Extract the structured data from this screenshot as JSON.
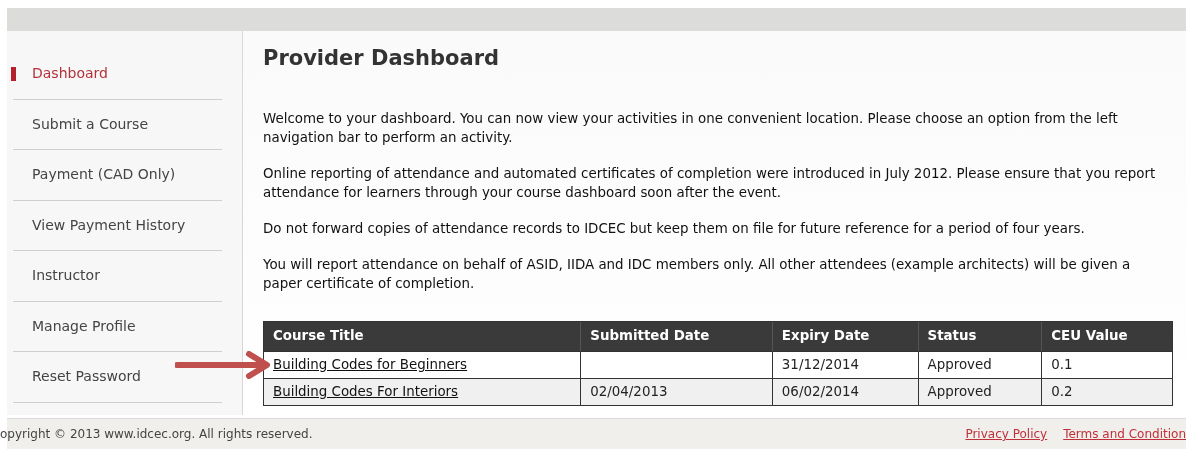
{
  "sidebar": {
    "items": [
      {
        "label": "Dashboard",
        "selected": true
      },
      {
        "label": "Submit a Course",
        "selected": false
      },
      {
        "label": "Payment (CAD Only)",
        "selected": false
      },
      {
        "label": "View Payment History",
        "selected": false
      },
      {
        "label": "Instructor",
        "selected": false
      },
      {
        "label": "Manage Profile",
        "selected": false
      },
      {
        "label": "Reset Password",
        "selected": false
      }
    ]
  },
  "page": {
    "title": "Provider Dashboard",
    "paragraphs": [
      "Welcome to your dashboard. You can now view your activities in one convenient location. Please choose an option from the left navigation bar to perform an activity.",
      "Online reporting of attendance and automated certificates of completion were introduced in July 2012. Please ensure that you report attendance for learners through your course dashboard soon after the event.",
      "Do not forward copies of attendance records to IDCEC but keep them on file for future reference for a period of four years.",
      "You will report attendance on behalf of ASID, IIDA and IDC members only. All other attendees (example architects) will be given a paper certificate of completion."
    ]
  },
  "table": {
    "columns": [
      "Course Title",
      "Submitted Date",
      "Expiry Date",
      "Status",
      "CEU Value"
    ],
    "rows": [
      {
        "title": "Building Codes for Beginners",
        "submitted_date": "",
        "expiry_date": "31/12/2014",
        "status": "Approved",
        "ceu_value": "0.1",
        "annotated": true
      },
      {
        "title": "Building Codes For Interiors",
        "submitted_date": "02/04/2013",
        "expiry_date": "06/02/2014",
        "status": "Approved",
        "ceu_value": "0.2",
        "annotated": false
      }
    ]
  },
  "footer": {
    "copyright": "opyright © 2013 www.idcec.org. All rights reserved.",
    "links": [
      "Privacy Policy",
      "Terms and Condition"
    ]
  }
}
